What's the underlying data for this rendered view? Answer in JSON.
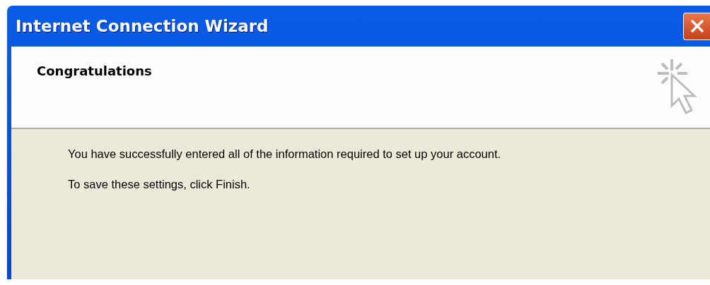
{
  "window": {
    "title": "Internet Connection Wizard"
  },
  "header": {
    "title": "Congratulations"
  },
  "body": {
    "paragraphs": [
      "You have successfully entered all of the information required to set up your account.",
      "To save these settings, click Finish."
    ]
  }
}
